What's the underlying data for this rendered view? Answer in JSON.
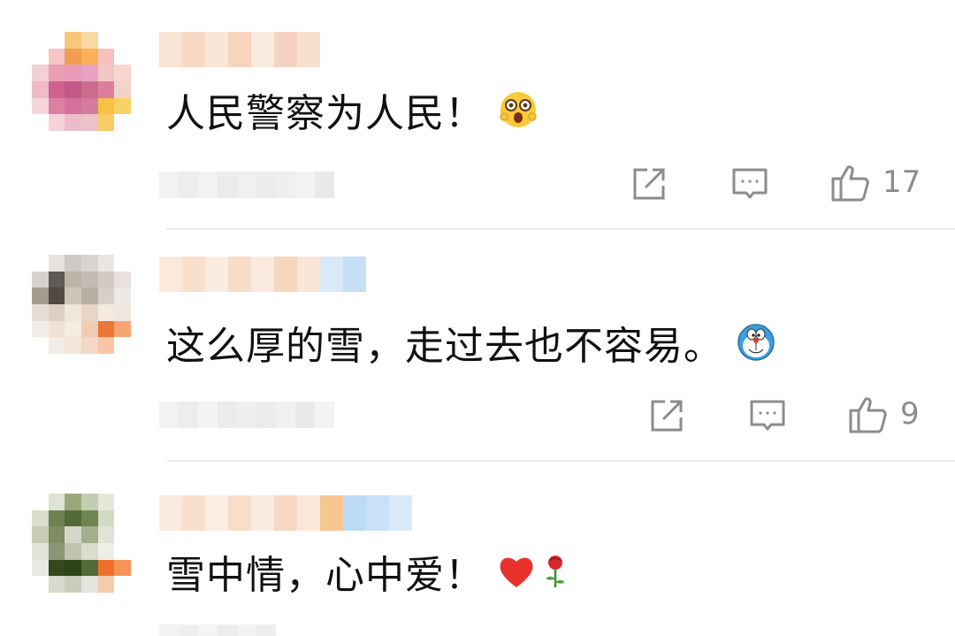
{
  "comments": [
    {
      "text": "人民警察为人民！",
      "emoji": "shocked-face-emoji",
      "like_count": "17"
    },
    {
      "text": "这么厚的雪，走过去也不容易。",
      "emoji": "doraemon-emoji",
      "like_count": "9"
    },
    {
      "text": "雪中情，心中爱！",
      "emoji": "heart-and-rose-emoji",
      "like_count": ""
    }
  ],
  "icons": {
    "repost": "repost-icon",
    "reply": "reply-icon",
    "like": "thumbs-up-icon"
  },
  "colors": {
    "icon_gray": "#8c8c8c",
    "text": "#111111",
    "divider": "#ececec"
  }
}
